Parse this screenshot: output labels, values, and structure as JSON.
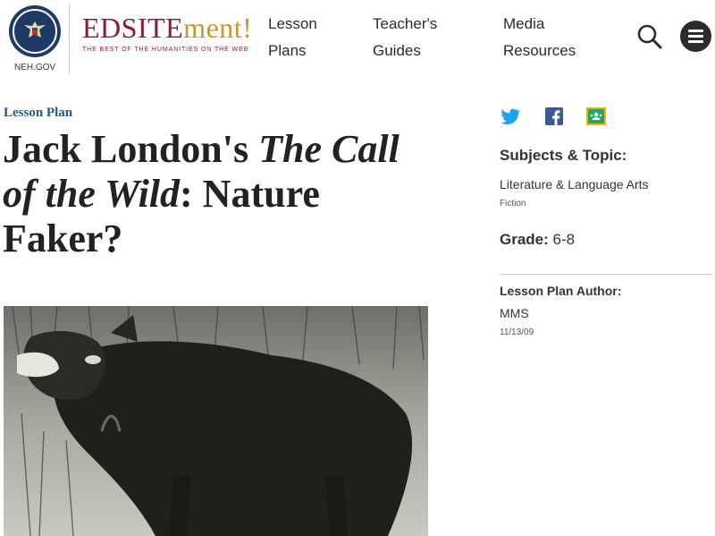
{
  "header": {
    "seal_label": "NEH.GOV",
    "logo_main": "EDSITE",
    "logo_accent": "ment!",
    "logo_tagline": "THE BEST OF THE HUMANITIES ON THE WEB",
    "nav": [
      {
        "line1": "Lesson",
        "line2": "Plans"
      },
      {
        "line1": "Teacher's",
        "line2": "Guides"
      },
      {
        "line1": "Media",
        "line2": "Resources"
      }
    ],
    "search_icon": "search-icon",
    "menu_icon": "hamburger-menu-icon"
  },
  "main": {
    "kicker": "Lesson Plan",
    "title_part1": "Jack London's ",
    "title_italic": "The Call of the Wild",
    "title_part2": ": Nature Faker?"
  },
  "sidebar": {
    "share_icons": [
      "twitter-icon",
      "facebook-icon",
      "google-classroom-icon"
    ],
    "subjects_heading": "Subjects & Topic:",
    "subject": "Literature & Language Arts",
    "topic": "Fiction",
    "grade_label": "Grade:",
    "grade_value": "6-8",
    "author_heading": "Lesson Plan Author:",
    "author": "MMS",
    "date": "11/13/09"
  },
  "colors": {
    "brand_red": "#8b1e2d",
    "brand_gold": "#c9962d",
    "link_blue": "#1e5a8c",
    "twitter": "#1da1f2",
    "facebook": "#3b5998",
    "classroom": "#25a667",
    "seal_navy": "#1f3a66"
  }
}
